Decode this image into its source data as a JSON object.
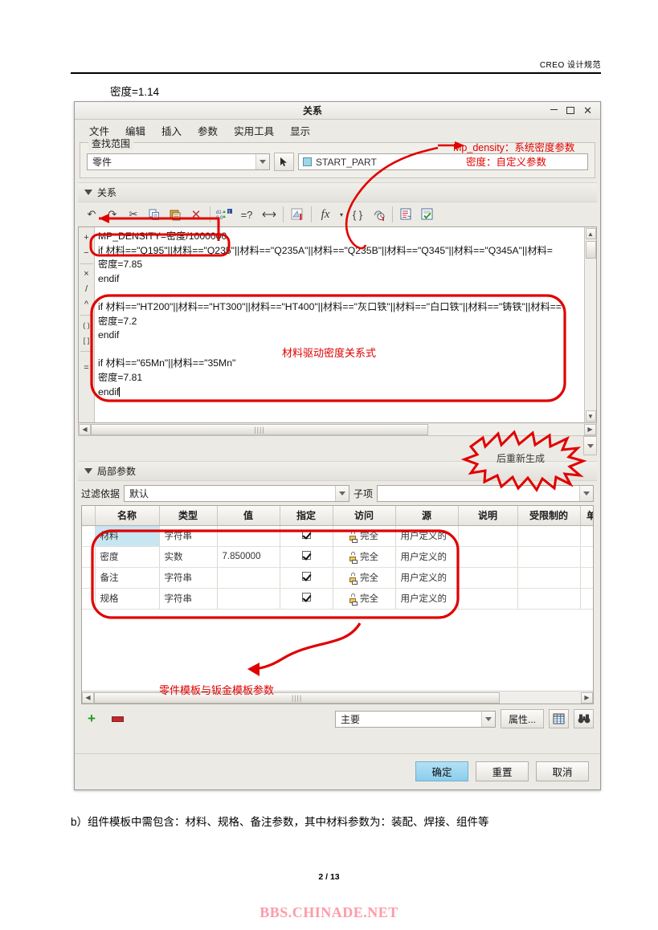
{
  "document": {
    "header_text": "CREO 设计规范",
    "above_dialog_text": "密度=1.14",
    "body_note": "b）组件模板中需包含：材料、规格、备注参数，其中材料参数为：装配、焊接、组件等",
    "page_number": "2 / 13",
    "site_mark": "BBS.CHINADE.NET"
  },
  "dialog": {
    "title": "关系",
    "window_controls": {
      "minimize": "−",
      "maximize": "□",
      "close": "✕"
    },
    "menu": [
      "文件",
      "编辑",
      "插入",
      "参数",
      "实用工具",
      "显示"
    ],
    "scope": {
      "group_title": "查找范围",
      "type_value": "零件",
      "picker_icon": "cursor-arrow-icon",
      "model_value": "START_PART"
    },
    "relations_section": {
      "header": "关系",
      "toolbar": [
        {
          "name": "undo",
          "glyph": "↶"
        },
        {
          "name": "redo",
          "glyph": "↷"
        },
        {
          "name": "cut",
          "glyph": "✂"
        },
        {
          "name": "copy",
          "glyph": "⎘"
        },
        {
          "name": "paste",
          "glyph": "📋"
        },
        {
          "name": "delete",
          "glyph": "✕"
        },
        {
          "name": "switch-dimensions",
          "glyph": "d1"
        },
        {
          "name": "evaluate",
          "glyph": "=?"
        },
        {
          "name": "insert-from-list",
          "glyph": "↔"
        },
        {
          "name": "units",
          "glyph": "◱"
        },
        {
          "name": "function",
          "glyph": "fx"
        },
        {
          "name": "function-dropdown",
          "glyph": "▾"
        },
        {
          "name": "parentheses",
          "glyph": "{ }"
        },
        {
          "name": "history",
          "glyph": "◷"
        },
        {
          "name": "show-relations",
          "glyph": "▤"
        },
        {
          "name": "verify-relations",
          "glyph": "☑"
        }
      ],
      "operators": [
        "+",
        "−",
        "×",
        "/",
        "^",
        "( )",
        "[ ]",
        "="
      ],
      "code_lines": [
        "MP_DENSITY=密度/1000000",
        "if 材料==\"Q195\"||材料==\"Q235\"||材料==\"Q235A\"||材料==\"Q235B\"||材料==\"Q345\"||材料==\"Q345A\"||材料=",
        "密度=7.85",
        "endif",
        "",
        "if 材料==\"HT200\"||材料==\"HT300\"||材料==\"HT400\"||材料==\"灰口铁\"||材料==\"白口铁\"||材料==\"铸铁\"||材料==",
        "密度=7.2",
        "endif",
        "",
        "if 材料==\"65Mn\"||材料==\"35Mn\"",
        "密度=7.81",
        "endif"
      ]
    },
    "local_params_section": {
      "header": "局部参数",
      "filter_label": "过滤依据",
      "filter_value": "默认",
      "subitem_label": "子项",
      "subitem_value": "",
      "columns": [
        "名称",
        "类型",
        "值",
        "指定",
        "访问",
        "源",
        "说明",
        "受限制的",
        "单位"
      ],
      "rows": [
        {
          "name": "材料",
          "type": "字符串",
          "value": "",
          "designate": true,
          "access": "完全",
          "source": "用户定义的",
          "description": "",
          "restricted": "",
          "unit": ""
        },
        {
          "name": "密度",
          "type": "实数",
          "value": "7.850000",
          "designate": true,
          "access": "完全",
          "source": "用户定义的",
          "description": "",
          "restricted": "",
          "unit": ""
        },
        {
          "name": "备注",
          "type": "字符串",
          "value": "",
          "designate": true,
          "access": "完全",
          "source": "用户定义的",
          "description": "",
          "restricted": "",
          "unit": ""
        },
        {
          "name": "规格",
          "type": "字符串",
          "value": "",
          "designate": true,
          "access": "完全",
          "source": "用户定义的",
          "description": "",
          "restricted": "",
          "unit": ""
        }
      ],
      "add_button": "+",
      "remove_button": "−",
      "main_filter_value": "主要",
      "properties_button": "属性...",
      "columns_button_icon": "columns-icon",
      "find_button_icon": "binoculars-icon"
    },
    "footer_buttons": {
      "ok": "确定",
      "reset": "重置",
      "cancel": "取消"
    }
  },
  "annotations": {
    "mp_density_note": "Mp_density：系统密度参数",
    "density_note": "密度：自定义参数",
    "relation_note": "材料驱动密度关系式",
    "regenerate_note": "后重新生成",
    "template_note": "零件模板与钣金模板参数"
  },
  "colors": {
    "annotation_red": "#e00000",
    "dialog_bg": "#eceae4",
    "selection_blue": "#c6e6f2",
    "primary_button": "#8bcdec",
    "site_mark_pink": "#ff9aa9"
  }
}
